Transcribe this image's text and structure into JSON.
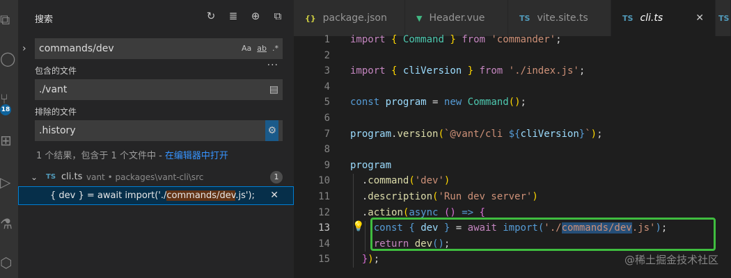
{
  "activity_bar": {
    "badge": "18"
  },
  "sidebar": {
    "title": "搜索",
    "search_value": "commands/dev",
    "opt_case": "Aa",
    "opt_word": "ab",
    "opt_regex": ".*",
    "include_label": "包含的文件",
    "include_value": "./vant",
    "exclude_label": "排除的文件",
    "exclude_value": ".history",
    "result_message": "1 个结果，包含于 1 个文件中 - ",
    "open_in_editor": "在编辑器中打开",
    "file": {
      "icon": "TS",
      "name": "cli.ts",
      "path": "vant • packages\\vant-cli\\src",
      "count": "1"
    },
    "match": {
      "before": "{ dev } = await import('./",
      "highlight": "commands/dev",
      "after": ".js');"
    }
  },
  "tabs": [
    {
      "icon": "{}",
      "label": "package.json",
      "icon_color": "#cbcb41"
    },
    {
      "icon": "▼",
      "label": "Header.vue",
      "icon_color": "#41b883"
    },
    {
      "icon": "TS",
      "label": "vite.site.ts",
      "icon_color": "#519aba"
    },
    {
      "icon": "TS",
      "label": "cli.ts",
      "icon_color": "#519aba"
    },
    {
      "icon": "TS",
      "label": "",
      "icon_color": "#519aba"
    }
  ],
  "editor": {
    "line_numbers": [
      "1",
      "2",
      "3",
      "4",
      "5",
      "6",
      "7",
      "8",
      "9",
      "10",
      "11",
      "12",
      "13",
      "14",
      "15"
    ],
    "code": {
      "l1_import": "import",
      "l1_cmd": "Command",
      "l1_from": "from",
      "l1_str": "'commander'",
      "l3_import": "import",
      "l3_var": "cliVersion",
      "l3_from": "from",
      "l3_str": "'./index.js'",
      "l5_const": "const",
      "l5_prog": "program",
      "l5_new": "new",
      "l5_cmd": "Command",
      "l7_prog": "program",
      "l7_fn": "version",
      "l7_tpl": "`@vant/cli ",
      "l7_var": "cliVersion",
      "l7_tpl_end": "`",
      "l9_prog": "program",
      "l10_fn": "command",
      "l10_str": "'dev'",
      "l11_fn": "description",
      "l11_str": "'Run dev server'",
      "l12_fn": "action",
      "l12_async": "async",
      "l13_const": "const",
      "l13_var": "dev",
      "l13_await": "await",
      "l13_import": "import",
      "l13_str1": "'./",
      "l13_str_hl": "commands/dev",
      "l13_str2": ".js'",
      "l14_return": "return",
      "l14_fn": "dev"
    }
  },
  "watermark": "@稀土掘金技术社区"
}
